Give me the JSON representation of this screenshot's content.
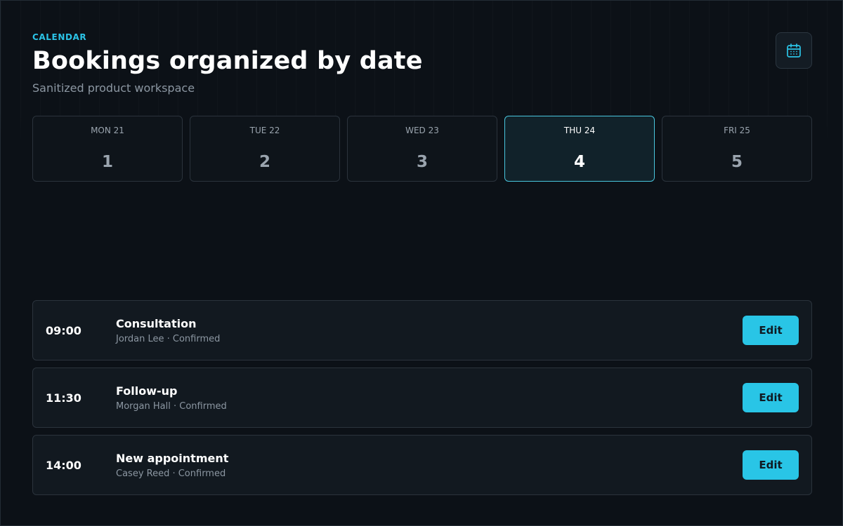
{
  "header": {
    "eyebrow": "CALENDAR",
    "title": "Bookings organized by date",
    "subtitle": "Sanitized product workspace",
    "calendar_icon": "calendar-icon"
  },
  "days": [
    {
      "label": "MON 21",
      "count": "1",
      "active": false
    },
    {
      "label": "TUE 22",
      "count": "2",
      "active": false
    },
    {
      "label": "WED 23",
      "count": "3",
      "active": false
    },
    {
      "label": "THU 24",
      "count": "4",
      "active": true
    },
    {
      "label": "FRI 25",
      "count": "5",
      "active": false
    }
  ],
  "bookings": [
    {
      "time": "09:00",
      "service": "Consultation",
      "meta": "Jordan Lee · Confirmed",
      "action": "Edit"
    },
    {
      "time": "11:30",
      "service": "Follow-up",
      "meta": "Morgan Hall · Confirmed",
      "action": "Edit"
    },
    {
      "time": "14:00",
      "service": "New appointment",
      "meta": "Casey Reed · Confirmed",
      "action": "Edit"
    }
  ],
  "colors": {
    "accent": "#29c5e6",
    "background": "#0c1117",
    "card": "#121920",
    "active_day_border": "#49c6de"
  }
}
